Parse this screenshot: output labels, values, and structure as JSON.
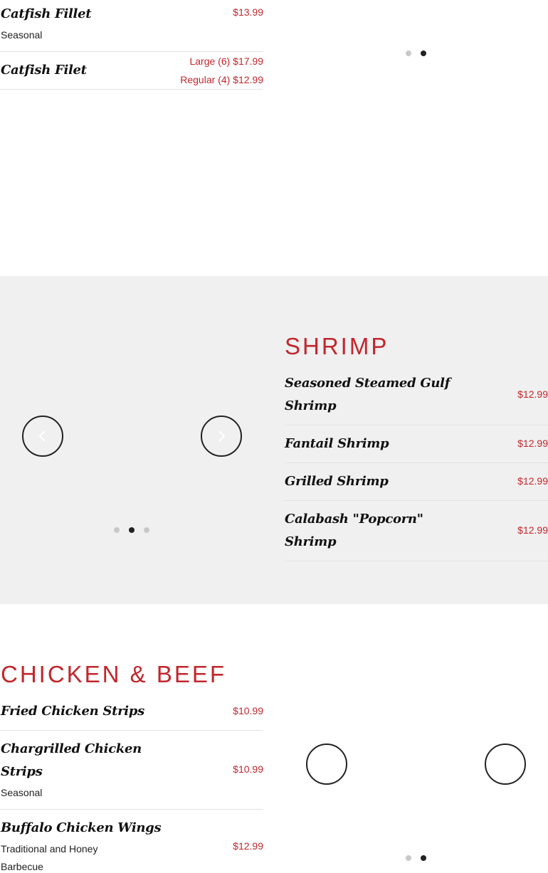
{
  "fish": {
    "items": [
      {
        "name": "Catfish Fillet",
        "desc": "Seasonal",
        "price": "$13.99"
      },
      {
        "name": "Catfish Filet",
        "price_large": "Large (6) $17.99",
        "price_regular": "Regular (4) $12.99"
      }
    ]
  },
  "top_carousel": {
    "dots": 2,
    "active": 1
  },
  "shrimp": {
    "title": "SHRIMP",
    "items": [
      {
        "name_line1": "Seasoned Steamed Gulf",
        "name_line2": "Shrimp",
        "price": "$12.99"
      },
      {
        "name": "Fantail Shrimp",
        "price": "$12.99"
      },
      {
        "name": "Grilled Shrimp",
        "price": "$12.99"
      },
      {
        "name_line1": "Calabash \"Popcorn\"",
        "name_line2": "Shrimp",
        "price": "$12.99"
      }
    ]
  },
  "shrimp_carousel": {
    "dots": 3,
    "active": 1,
    "prev_icon": "chevron-left-icon",
    "next_icon": "chevron-right-icon"
  },
  "chicken_beef": {
    "title": "CHICKEN & BEEF",
    "items": [
      {
        "name": "Fried Chicken Strips",
        "price": "$10.99"
      },
      {
        "name_line1": "Chargrilled Chicken",
        "name_line2": "Strips",
        "desc": "Seasonal",
        "price": "$10.99"
      },
      {
        "name": "Buffalo Chicken Wings",
        "desc_line1": "Traditional and Honey",
        "desc_line2": "Barbecue",
        "price": "$12.99"
      }
    ]
  },
  "chicken_carousel": {
    "dots": 2,
    "active": 1
  },
  "colors": {
    "accent": "#c1272d",
    "band": "#f0f0f0",
    "text": "#111111"
  }
}
